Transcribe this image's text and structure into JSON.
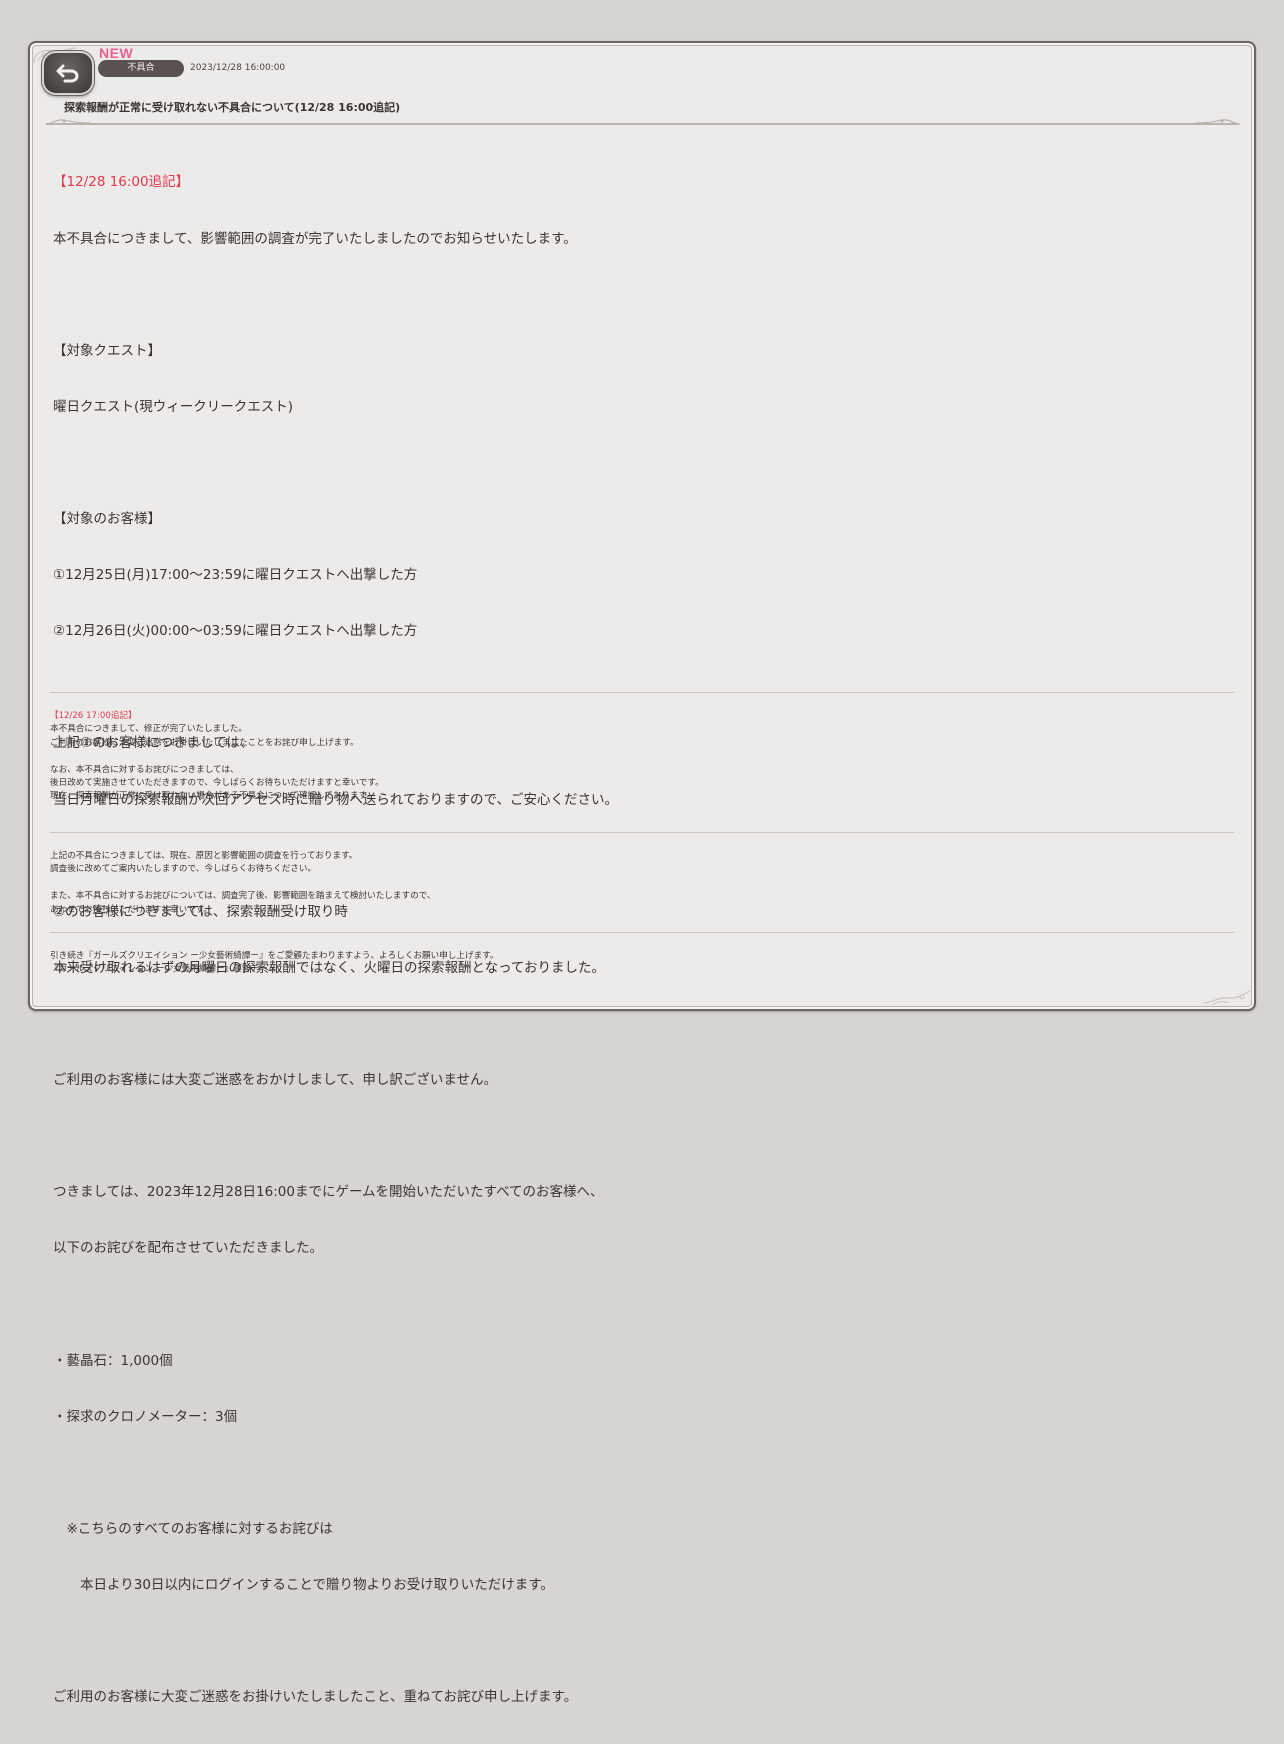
{
  "header": {
    "new_badge": "NEW",
    "category": "不具合",
    "date": "2023/12/28 16:00:00",
    "title": "探索報酬が正常に受け取れない不具合について(12/28 16:00追記)"
  },
  "icons": {
    "back": "return-arrow-icon"
  },
  "colors": {
    "highlight": "#e23a4e",
    "new_badge": "#e8628e",
    "pill_bg": "#5a5250"
  },
  "main": {
    "update_heading": "【12/28 16:00追記】",
    "lines": [
      "本不具合につきまして、影響範囲の調査が完了いたしましたのでお知らせいたします。",
      "",
      "【対象クエスト】",
      "曜日クエスト(現ウィークリークエスト)",
      "",
      "【対象のお客様】",
      "①12月25日(月)17:00～23:59に曜日クエストへ出撃した方",
      "②12月26日(火)00:00～03:59に曜日クエストへ出撃した方",
      "",
      "上記①のお客様につきましては、",
      "当日月曜日の探索報酬が次回アクセス時に贈り物へ送られておりますので、ご安心ください。",
      "",
      "②のお客様につきましては、探索報酬受け取り時",
      "本来受け取れるはずの月曜日の探索報酬ではなく、火曜日の探索報酬となっておりました。",
      "",
      "ご利用のお客様には大変ご迷惑をおかけしまして、申し訳ございません。",
      "",
      "つきましては、2023年12月28日16:00までにゲームを開始いただいたすべてのお客様へ、",
      "以下のお詫びを配布させていただきました。",
      "",
      "・藝晶石：1,000個",
      "・探求のクロノメーター：3個",
      "",
      "　※こちらのすべてのお客様に対するお詫びは",
      "　　本日より30日以内にログインすることで贈り物よりお受け取りいただけます。",
      "",
      "ご利用のお客様に大変ご迷惑をお掛けいたしましたこと、重ねてお詫び申し上げます。"
    ]
  },
  "section2": {
    "update_heading": "【12/26 17:00追記】",
    "lines": [
      "本不具合につきまして、修正が完了いたしました。",
      "ご利用のお客様に大変ご迷惑をお掛けいたしましたことをお詫び申し上げます。",
      "",
      "なお、本不具合に対するお詫びにつきましては、",
      "後日改めて実施させていただきますので、今しばらくお待ちいただけますと幸いです。",
      "現在、探索報酬が正常に受け取れない場合がある不具合について確認しております。"
    ]
  },
  "section3": {
    "lines": [
      "上記の不具合につきましては、現在、原因と影響範囲の調査を行っております。",
      "調査後に改めてご案内いたしますので、今しばらくお待ちください。",
      "",
      "また、本不具合に対するお詫びについては、調査完了後、影響範囲を踏まえて検討いたしますので、",
      "あわせてお待ちいただけますと幸いです。"
    ]
  },
  "footer": {
    "lines": [
      "引き続き『ガールズクリエイション ー少女藝術綺譚ー』をご愛顧たまわりますよう、よろしくお願い申し上げます。",
      "『ガールズクリエイション ー少女藝術綺譚ー』運営チーム"
    ]
  }
}
